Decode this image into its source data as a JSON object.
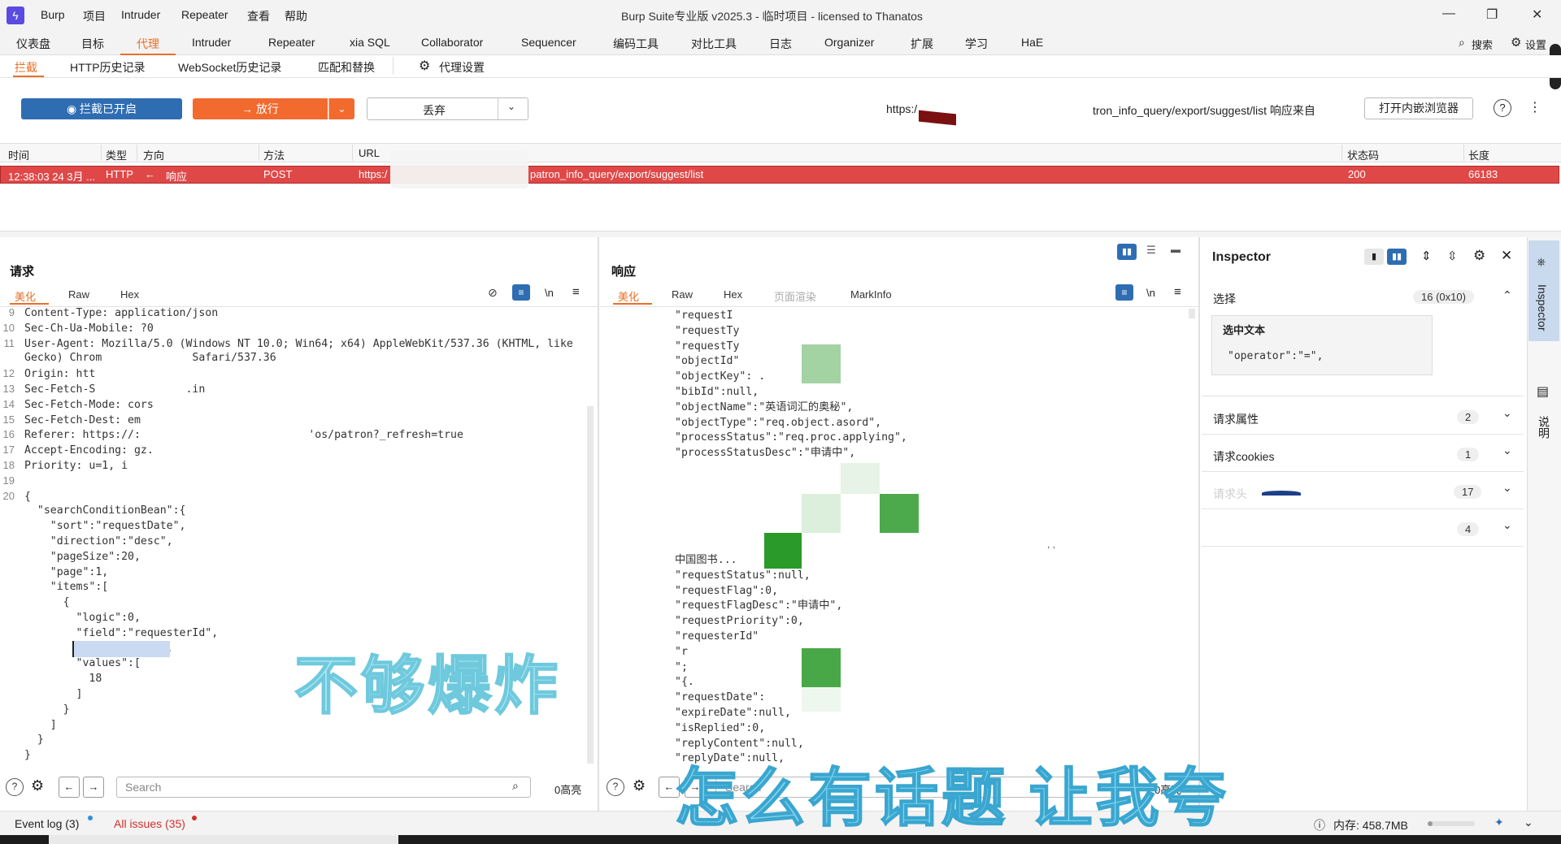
{
  "titlebar": {
    "menus": [
      "Burp",
      "项目",
      "Intruder",
      "Repeater",
      "查看",
      "帮助"
    ],
    "window_title": "Burp Suite专业版  v2025.3 - 临时项目 - licensed to Thanatos",
    "minimize": "—",
    "maximize": "❐",
    "close": "✕"
  },
  "main_tabs": [
    "仪表盘",
    "目标",
    "代理",
    "Intruder",
    "Repeater",
    "xia SQL",
    "Collaborator",
    "Sequencer",
    "编码工具",
    "对比工具",
    "日志",
    "Organizer",
    "扩展",
    "学习",
    "HaE"
  ],
  "top_search": "搜索",
  "top_settings": "设置",
  "sub_tabs": [
    "拦截",
    "HTTP历史记录",
    "WebSocket历史记录",
    "匹配和替换",
    "代理设置"
  ],
  "toolbar": {
    "intercept_label": "拦截已开启",
    "forward_label": "放行",
    "drop_label": "丢弃",
    "url_prefix": "https:/",
    "url_info": "tron_info_query/export/suggest/list 响应来自",
    "open_browser": "打开内嵌浏览器"
  },
  "table": {
    "headers": [
      "时间",
      "类型",
      "方向",
      "方法",
      "URL",
      "状态码",
      "长度"
    ],
    "rows": [
      {
        "time": "12:38:03 24 3月 ...",
        "type": "HTTP",
        "direction": "响应",
        "method": "POST",
        "url": "https:/",
        "url_tail": "patron_info_query/export/suggest/list",
        "status": "200",
        "length": "66183"
      }
    ]
  },
  "request": {
    "title": "请求",
    "tabs": [
      "美化",
      "Raw",
      "Hex"
    ],
    "lines": [
      {
        "n": "9",
        "t": "Content-Type: application/json"
      },
      {
        "n": "10",
        "t": "Sec-Ch-Ua-Mobile: ?0"
      },
      {
        "n": "11",
        "t": "User-Agent: Mozilla/5.0 (Windows NT 10.0; Win64; x64) AppleWebKit/537.36 (KHTML, like"
      },
      {
        "n": "",
        "t": "Gecko) Chrom              Safari/537.36"
      },
      {
        "n": "12",
        "t": "Origin: htt"
      },
      {
        "n": "13",
        "t": "Sec-Fetch-S              .in"
      },
      {
        "n": "14",
        "t": "Sec-Fetch-Mode: cors"
      },
      {
        "n": "15",
        "t": "Sec-Fetch-Dest: em"
      },
      {
        "n": "16",
        "t": "Referer: https://:                          'os/patron?_refresh=true"
      },
      {
        "n": "17",
        "t": "Accept-Encoding: gz."
      },
      {
        "n": "18",
        "t": "Priority: u=1, i"
      },
      {
        "n": "19",
        "t": ""
      },
      {
        "n": "20",
        "t": "{"
      },
      {
        "n": "",
        "t": "  \"searchConditionBean\":{"
      },
      {
        "n": "",
        "t": "    \"sort\":\"requestDate\","
      },
      {
        "n": "",
        "t": "    \"direction\":\"desc\","
      },
      {
        "n": "",
        "t": "    \"pageSize\":20,"
      },
      {
        "n": "",
        "t": "    \"page\":1,"
      },
      {
        "n": "",
        "t": "    \"items\":["
      },
      {
        "n": "",
        "t": "      {"
      },
      {
        "n": "",
        "t": "        \"logic\":0,"
      },
      {
        "n": "",
        "t": "        \"field\":\"requesterId\","
      },
      {
        "n": "",
        "t": "        \"operator\":\"=\","
      },
      {
        "n": "",
        "t": "        \"values\":["
      },
      {
        "n": "",
        "t": "          18"
      },
      {
        "n": "",
        "t": "        ]"
      },
      {
        "n": "",
        "t": "      }"
      },
      {
        "n": "",
        "t": "    ]"
      },
      {
        "n": "",
        "t": "  }"
      },
      {
        "n": "",
        "t": "}"
      }
    ],
    "search_placeholder": "Search",
    "highlights": "0高亮"
  },
  "response": {
    "title": "响应",
    "tabs": [
      "美化",
      "Raw",
      "Hex",
      "页面渲染",
      "MarkInfo"
    ],
    "lines": [
      "\"requestI",
      "\"requestTy",
      "\"requestTy",
      "\"objectId\"",
      "\"objectKey\": .",
      "\"bibId\":null,",
      "\"objectName\":\"英语词汇的奥秘\",",
      "\"objectType\":\"req.object.asord\",",
      "\"processStatus\":\"req.proc.applying\",",
      "\"processStatusDesc\":\"申请中\","
    ],
    "lines2": [
      "中国图书...",
      "\"requestStatus\":null,",
      "\"requestFlag\":0,",
      "\"requestFlagDesc\":\"申请中\",",
      "\"requestPriority\":0,",
      "\"requesterId\"",
      "\"r",
      "\";",
      "\"{.",
      "\"requestDate\":",
      "\"expireDate\":null,",
      "\"isReplied\":0,",
      "\"replyContent\":null,",
      "\"replyDate\":null,"
    ],
    "search_placeholder": "Search",
    "highlights": "0高亮"
  },
  "inspector": {
    "title": "Inspector",
    "selection_label": "选择",
    "selection_count": "16 (0x10)",
    "selected_text_label": "选中文本",
    "selected_text": "\"operator\":\"=\",",
    "sections": [
      {
        "label": "请求属性",
        "count": "2"
      },
      {
        "label": "请求cookies",
        "count": "1"
      },
      {
        "label": "请求头",
        "count": "17"
      },
      {
        "label": "",
        "count": "4"
      }
    ],
    "rail_label": "Inspector",
    "rail_label2": "说明"
  },
  "status": {
    "event_log": "Event log (3)",
    "issues": "All issues (35)",
    "memory": "内存: 458.7MB"
  },
  "overlays": {
    "text1": "不够爆炸",
    "text2": "怎么有话题  让我夸"
  },
  "colors": {
    "accent": "#e8702a",
    "intercept_blue": "#2f6db3",
    "forward_orange": "#f26a2e",
    "selected_row": "#e04848"
  }
}
